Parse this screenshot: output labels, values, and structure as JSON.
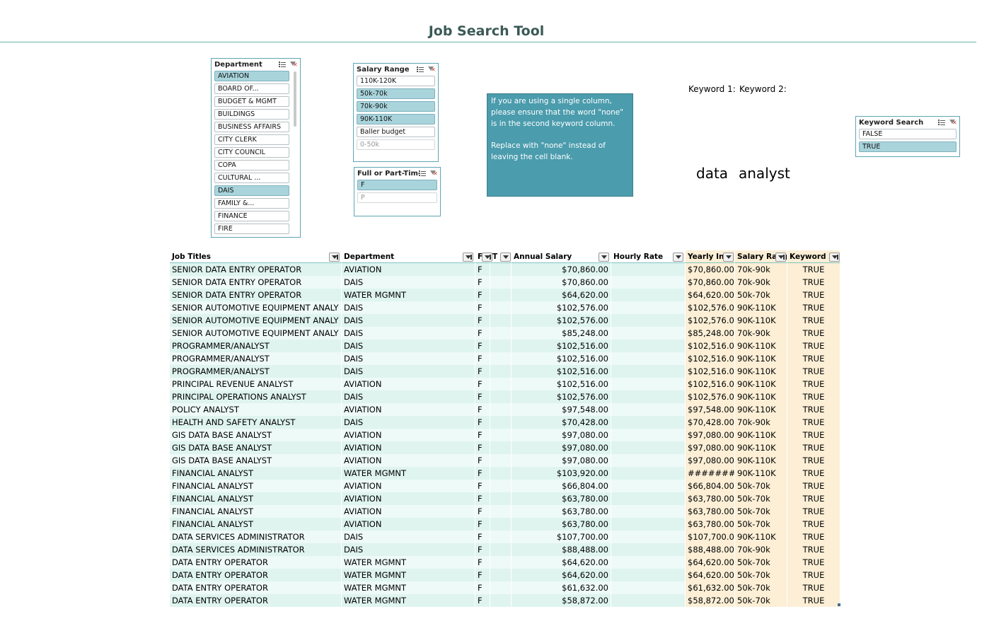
{
  "title": "Job Search Tool",
  "slicers": {
    "department": {
      "header": "Department",
      "items": [
        {
          "label": "AVIATION",
          "state": "selected"
        },
        {
          "label": "BOARD OF...",
          "state": "normal"
        },
        {
          "label": "BUDGET & MGMT",
          "state": "normal"
        },
        {
          "label": "BUILDINGS",
          "state": "normal"
        },
        {
          "label": "BUSINESS AFFAIRS",
          "state": "normal"
        },
        {
          "label": "CITY CLERK",
          "state": "normal"
        },
        {
          "label": "CITY COUNCIL",
          "state": "normal"
        },
        {
          "label": "COPA",
          "state": "normal"
        },
        {
          "label": "CULTURAL ...",
          "state": "normal"
        },
        {
          "label": "DAIS",
          "state": "selected"
        },
        {
          "label": "FAMILY &...",
          "state": "normal"
        },
        {
          "label": "FINANCE",
          "state": "normal"
        },
        {
          "label": "FIRE",
          "state": "normal"
        }
      ]
    },
    "salary_range": {
      "header": "Salary Range",
      "items": [
        {
          "label": "110K-120K",
          "state": "normal"
        },
        {
          "label": "50k-70k",
          "state": "selected"
        },
        {
          "label": "70k-90k",
          "state": "selected"
        },
        {
          "label": "90K-110K",
          "state": "selected"
        },
        {
          "label": "Baller budget",
          "state": "normal"
        },
        {
          "label": "0-50k",
          "state": "dim"
        }
      ]
    },
    "full_part": {
      "header": "Full or Part-Time",
      "items": [
        {
          "label": "F",
          "state": "selected"
        },
        {
          "label": "P",
          "state": "dim"
        }
      ]
    },
    "keyword_search": {
      "header": "Keyword Search",
      "items": [
        {
          "label": "FALSE",
          "state": "normal"
        },
        {
          "label": "TRUE",
          "state": "selected"
        }
      ]
    }
  },
  "note": {
    "line1": "If you are using a single column, please ensure that the word \"none\" is in the second keyword column.",
    "line2": "Replace with \"none\" instead of leaving the cell blank."
  },
  "keywords": {
    "label1": "Keyword 1:",
    "label2": "Keyword 2:",
    "value1": "data",
    "value2": "analyst"
  },
  "table": {
    "headers": [
      "Job Titles",
      "Department",
      "F",
      "T",
      "Annual Salary",
      "Hourly Rate",
      "Yearly Inco",
      "Salary Rang",
      "Keyword Search"
    ],
    "rows": [
      [
        "SENIOR DATA ENTRY OPERATOR",
        "AVIATION",
        "F",
        "",
        "$70,860.00",
        "",
        "$70,860.00",
        "70k-90k",
        "TRUE"
      ],
      [
        "SENIOR DATA ENTRY OPERATOR",
        "DAIS",
        "F",
        "",
        "$70,860.00",
        "",
        "$70,860.00",
        "70k-90k",
        "TRUE"
      ],
      [
        "SENIOR DATA ENTRY OPERATOR",
        "WATER MGMNT",
        "F",
        "",
        "$64,620.00",
        "",
        "$64,620.00",
        "50k-70k",
        "TRUE"
      ],
      [
        "SENIOR AUTOMOTIVE EQUIPMENT ANALY",
        "DAIS",
        "F",
        "",
        "$102,576.00",
        "",
        "$102,576.00",
        "90K-110K",
        "TRUE"
      ],
      [
        "SENIOR AUTOMOTIVE EQUIPMENT ANALY",
        "DAIS",
        "F",
        "",
        "$102,576.00",
        "",
        "$102,576.00",
        "90K-110K",
        "TRUE"
      ],
      [
        "SENIOR AUTOMOTIVE EQUIPMENT ANALY",
        "DAIS",
        "F",
        "",
        "$85,248.00",
        "",
        "$85,248.00",
        "70k-90k",
        "TRUE"
      ],
      [
        "PROGRAMMER/ANALYST",
        "DAIS",
        "F",
        "",
        "$102,516.00",
        "",
        "$102,516.00",
        "90K-110K",
        "TRUE"
      ],
      [
        "PROGRAMMER/ANALYST",
        "DAIS",
        "F",
        "",
        "$102,516.00",
        "",
        "$102,516.00",
        "90K-110K",
        "TRUE"
      ],
      [
        "PROGRAMMER/ANALYST",
        "DAIS",
        "F",
        "",
        "$102,516.00",
        "",
        "$102,516.00",
        "90K-110K",
        "TRUE"
      ],
      [
        "PRINCIPAL REVENUE ANALYST",
        "AVIATION",
        "F",
        "",
        "$102,516.00",
        "",
        "$102,516.00",
        "90K-110K",
        "TRUE"
      ],
      [
        "PRINCIPAL OPERATIONS ANALYST",
        "DAIS",
        "F",
        "",
        "$102,576.00",
        "",
        "$102,576.00",
        "90K-110K",
        "TRUE"
      ],
      [
        "POLICY ANALYST",
        "AVIATION",
        "F",
        "",
        "$97,548.00",
        "",
        "$97,548.00",
        "90K-110K",
        "TRUE"
      ],
      [
        "HEALTH AND SAFETY ANALYST",
        "DAIS",
        "F",
        "",
        "$70,428.00",
        "",
        "$70,428.00",
        "70k-90k",
        "TRUE"
      ],
      [
        "GIS DATA BASE ANALYST",
        "AVIATION",
        "F",
        "",
        "$97,080.00",
        "",
        "$97,080.00",
        "90K-110K",
        "TRUE"
      ],
      [
        "GIS DATA BASE ANALYST",
        "AVIATION",
        "F",
        "",
        "$97,080.00",
        "",
        "$97,080.00",
        "90K-110K",
        "TRUE"
      ],
      [
        "GIS DATA BASE ANALYST",
        "AVIATION",
        "F",
        "",
        "$97,080.00",
        "",
        "$97,080.00",
        "90K-110K",
        "TRUE"
      ],
      [
        "FINANCIAL ANALYST",
        "WATER MGMNT",
        "F",
        "",
        "$103,920.00",
        "",
        "#######",
        "90K-110K",
        "TRUE"
      ],
      [
        "FINANCIAL ANALYST",
        "AVIATION",
        "F",
        "",
        "$66,804.00",
        "",
        "$66,804.00",
        "50k-70k",
        "TRUE"
      ],
      [
        "FINANCIAL ANALYST",
        "AVIATION",
        "F",
        "",
        "$63,780.00",
        "",
        "$63,780.00",
        "50k-70k",
        "TRUE"
      ],
      [
        "FINANCIAL ANALYST",
        "AVIATION",
        "F",
        "",
        "$63,780.00",
        "",
        "$63,780.00",
        "50k-70k",
        "TRUE"
      ],
      [
        "FINANCIAL ANALYST",
        "AVIATION",
        "F",
        "",
        "$63,780.00",
        "",
        "$63,780.00",
        "50k-70k",
        "TRUE"
      ],
      [
        "DATA SERVICES ADMINISTRATOR",
        "DAIS",
        "F",
        "",
        "$107,700.00",
        "",
        "$107,700.00",
        "90K-110K",
        "TRUE"
      ],
      [
        "DATA SERVICES ADMINISTRATOR",
        "DAIS",
        "F",
        "",
        "$88,488.00",
        "",
        "$88,488.00",
        "70k-90k",
        "TRUE"
      ],
      [
        "DATA ENTRY OPERATOR",
        "WATER MGMNT",
        "F",
        "",
        "$64,620.00",
        "",
        "$64,620.00",
        "50k-70k",
        "TRUE"
      ],
      [
        "DATA ENTRY OPERATOR",
        "WATER MGMNT",
        "F",
        "",
        "$64,620.00",
        "",
        "$64,620.00",
        "50k-70k",
        "TRUE"
      ],
      [
        "DATA ENTRY OPERATOR",
        "WATER MGMNT",
        "F",
        "",
        "$61,632.00",
        "",
        "$61,632.00",
        "50k-70k",
        "TRUE"
      ],
      [
        "DATA ENTRY OPERATOR",
        "WATER MGMNT",
        "F",
        "",
        "$58,872.00",
        "",
        "$58,872.00",
        "50k-70k",
        "TRUE"
      ]
    ]
  },
  "colors": {
    "accent": "#4b9cad",
    "selected_item": "#a9d4dc",
    "row_band_a": "#dff4ef",
    "row_band_b": "#eefaf7",
    "calc_column": "#fcefd6"
  }
}
